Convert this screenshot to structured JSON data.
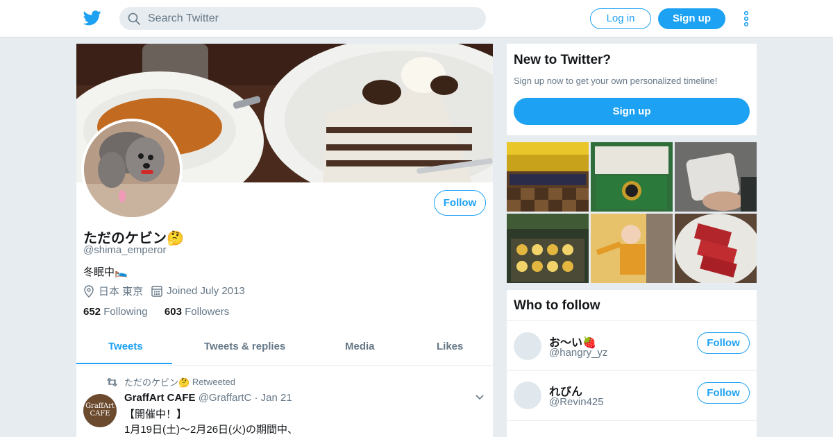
{
  "header": {
    "search_placeholder": "Search Twitter",
    "login_label": "Log in",
    "signup_label": "Sign up",
    "accent": "#1da1f2"
  },
  "profile": {
    "display_name": "ただのケビン🤔",
    "handle": "@shima_emperor",
    "bio": "冬眠中🛌",
    "location": "日本 東京",
    "joined": "Joined July 2013",
    "following_count": "652",
    "following_label": "Following",
    "followers_count": "603",
    "followers_label": "Followers",
    "follow_label": "Follow"
  },
  "tabs": [
    {
      "label": "Tweets",
      "active": true
    },
    {
      "label": "Tweets & replies",
      "active": false
    },
    {
      "label": "Media",
      "active": false
    },
    {
      "label": "Likes",
      "active": false
    }
  ],
  "tweet": {
    "retweet_by": "ただのケビン🤔",
    "retweet_label": "Retweeted",
    "author": "GraffArt CAFE",
    "author_handle": "@GraffartC",
    "date": "Jan 21",
    "avatar_text": "GraffArt CAFE",
    "line1": "【開催中！】",
    "line2": "1月19日(土)〜2月26日(火)の期間中、"
  },
  "new_to_twitter": {
    "title": "New to Twitter?",
    "subtitle": "Sign up now to get your own personalized timeline!",
    "button": "Sign up"
  },
  "media_thumbnails": [
    {
      "icon": "game-screenshot"
    },
    {
      "icon": "watch-in-box"
    },
    {
      "icon": "snack-package"
    },
    {
      "icon": "game-gacha-screenshot"
    },
    {
      "icon": "performer-on-stage"
    },
    {
      "icon": "raw-meat-plate"
    }
  ],
  "who_to_follow": {
    "title": "Who to follow",
    "follow_label": "Follow",
    "users": [
      {
        "name": "お～い🍓",
        "handle": "@hangry_yz"
      },
      {
        "name": "れびん",
        "handle": "@Revin425"
      }
    ]
  }
}
